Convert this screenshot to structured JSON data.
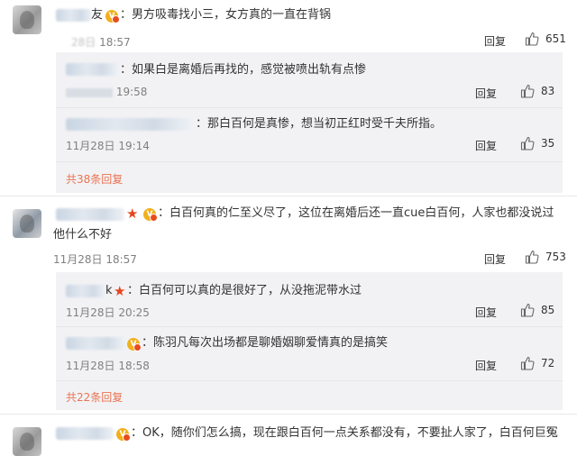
{
  "comments": [
    {
      "text": "男方吸毒找小三，女方真的一直在背锅",
      "name_suffix": "友",
      "time": "18:57",
      "time_prefix": "28日",
      "reply": "回复",
      "likes": "651"
    },
    {
      "text": "白百何真的仁至义尽了，这位在离婚后还一直cue白百何，人家也都没说过",
      "text2": "他什么不好",
      "time": "11月28日 18:57",
      "reply": "回复",
      "likes": "753"
    },
    {
      "text": "OK，随你们怎么搞，现在跟白百何一点关系都没有，不要扯人家了，白百何巨冤"
    }
  ],
  "replies_group1": [
    {
      "text": "如果白是离婚后再找的，感觉被喷出轨有点惨",
      "time": "19:58",
      "reply": "回复",
      "likes": "83"
    },
    {
      "text": "那白百何是真惨，想当初正红时受千夫所指。",
      "time": "11月28日 19:14",
      "reply": "回复",
      "likes": "35"
    }
  ],
  "more_group1": "共38条回复",
  "replies_group2": [
    {
      "name": "k",
      "text": "白百何可以真的是很好了，从没拖泥带水过",
      "time": "11月28日 20:25",
      "reply": "回复",
      "likes": "85"
    },
    {
      "text": "陈羽凡每次出场都是聊婚姻聊爱情真的是搞笑",
      "time": "11月28日 18:58",
      "reply": "回复",
      "likes": "72"
    }
  ],
  "more_group2": "共22条回复",
  "colors": {
    "link": "#eb7350",
    "reply_bg": "#f2f2f5",
    "vip": "#f2b01e",
    "star": "#e3461e"
  }
}
